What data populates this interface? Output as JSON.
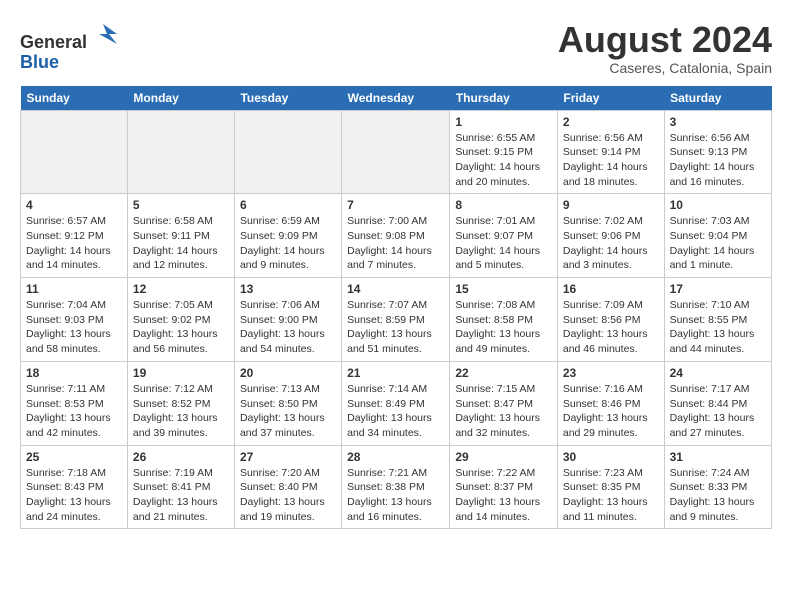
{
  "header": {
    "logo_line1": "General",
    "logo_line2": "Blue",
    "month_year": "August 2024",
    "location": "Caseres, Catalonia, Spain"
  },
  "weekdays": [
    "Sunday",
    "Monday",
    "Tuesday",
    "Wednesday",
    "Thursday",
    "Friday",
    "Saturday"
  ],
  "weeks": [
    [
      {
        "day": "",
        "empty": true
      },
      {
        "day": "",
        "empty": true
      },
      {
        "day": "",
        "empty": true
      },
      {
        "day": "",
        "empty": true
      },
      {
        "day": "1",
        "info": "Sunrise: 6:55 AM\nSunset: 9:15 PM\nDaylight: 14 hours\nand 20 minutes."
      },
      {
        "day": "2",
        "info": "Sunrise: 6:56 AM\nSunset: 9:14 PM\nDaylight: 14 hours\nand 18 minutes."
      },
      {
        "day": "3",
        "info": "Sunrise: 6:56 AM\nSunset: 9:13 PM\nDaylight: 14 hours\nand 16 minutes."
      }
    ],
    [
      {
        "day": "4",
        "info": "Sunrise: 6:57 AM\nSunset: 9:12 PM\nDaylight: 14 hours\nand 14 minutes."
      },
      {
        "day": "5",
        "info": "Sunrise: 6:58 AM\nSunset: 9:11 PM\nDaylight: 14 hours\nand 12 minutes."
      },
      {
        "day": "6",
        "info": "Sunrise: 6:59 AM\nSunset: 9:09 PM\nDaylight: 14 hours\nand 9 minutes."
      },
      {
        "day": "7",
        "info": "Sunrise: 7:00 AM\nSunset: 9:08 PM\nDaylight: 14 hours\nand 7 minutes."
      },
      {
        "day": "8",
        "info": "Sunrise: 7:01 AM\nSunset: 9:07 PM\nDaylight: 14 hours\nand 5 minutes."
      },
      {
        "day": "9",
        "info": "Sunrise: 7:02 AM\nSunset: 9:06 PM\nDaylight: 14 hours\nand 3 minutes."
      },
      {
        "day": "10",
        "info": "Sunrise: 7:03 AM\nSunset: 9:04 PM\nDaylight: 14 hours\nand 1 minute."
      }
    ],
    [
      {
        "day": "11",
        "info": "Sunrise: 7:04 AM\nSunset: 9:03 PM\nDaylight: 13 hours\nand 58 minutes."
      },
      {
        "day": "12",
        "info": "Sunrise: 7:05 AM\nSunset: 9:02 PM\nDaylight: 13 hours\nand 56 minutes."
      },
      {
        "day": "13",
        "info": "Sunrise: 7:06 AM\nSunset: 9:00 PM\nDaylight: 13 hours\nand 54 minutes."
      },
      {
        "day": "14",
        "info": "Sunrise: 7:07 AM\nSunset: 8:59 PM\nDaylight: 13 hours\nand 51 minutes."
      },
      {
        "day": "15",
        "info": "Sunrise: 7:08 AM\nSunset: 8:58 PM\nDaylight: 13 hours\nand 49 minutes."
      },
      {
        "day": "16",
        "info": "Sunrise: 7:09 AM\nSunset: 8:56 PM\nDaylight: 13 hours\nand 46 minutes."
      },
      {
        "day": "17",
        "info": "Sunrise: 7:10 AM\nSunset: 8:55 PM\nDaylight: 13 hours\nand 44 minutes."
      }
    ],
    [
      {
        "day": "18",
        "info": "Sunrise: 7:11 AM\nSunset: 8:53 PM\nDaylight: 13 hours\nand 42 minutes."
      },
      {
        "day": "19",
        "info": "Sunrise: 7:12 AM\nSunset: 8:52 PM\nDaylight: 13 hours\nand 39 minutes."
      },
      {
        "day": "20",
        "info": "Sunrise: 7:13 AM\nSunset: 8:50 PM\nDaylight: 13 hours\nand 37 minutes."
      },
      {
        "day": "21",
        "info": "Sunrise: 7:14 AM\nSunset: 8:49 PM\nDaylight: 13 hours\nand 34 minutes."
      },
      {
        "day": "22",
        "info": "Sunrise: 7:15 AM\nSunset: 8:47 PM\nDaylight: 13 hours\nand 32 minutes."
      },
      {
        "day": "23",
        "info": "Sunrise: 7:16 AM\nSunset: 8:46 PM\nDaylight: 13 hours\nand 29 minutes."
      },
      {
        "day": "24",
        "info": "Sunrise: 7:17 AM\nSunset: 8:44 PM\nDaylight: 13 hours\nand 27 minutes."
      }
    ],
    [
      {
        "day": "25",
        "info": "Sunrise: 7:18 AM\nSunset: 8:43 PM\nDaylight: 13 hours\nand 24 minutes."
      },
      {
        "day": "26",
        "info": "Sunrise: 7:19 AM\nSunset: 8:41 PM\nDaylight: 13 hours\nand 21 minutes."
      },
      {
        "day": "27",
        "info": "Sunrise: 7:20 AM\nSunset: 8:40 PM\nDaylight: 13 hours\nand 19 minutes."
      },
      {
        "day": "28",
        "info": "Sunrise: 7:21 AM\nSunset: 8:38 PM\nDaylight: 13 hours\nand 16 minutes."
      },
      {
        "day": "29",
        "info": "Sunrise: 7:22 AM\nSunset: 8:37 PM\nDaylight: 13 hours\nand 14 minutes."
      },
      {
        "day": "30",
        "info": "Sunrise: 7:23 AM\nSunset: 8:35 PM\nDaylight: 13 hours\nand 11 minutes."
      },
      {
        "day": "31",
        "info": "Sunrise: 7:24 AM\nSunset: 8:33 PM\nDaylight: 13 hours\nand 9 minutes."
      }
    ]
  ]
}
